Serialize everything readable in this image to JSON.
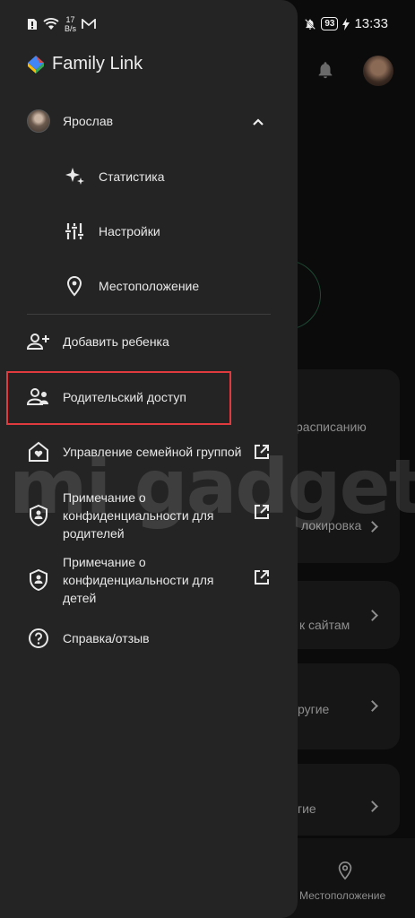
{
  "status_bar": {
    "net_speed_value": "17",
    "net_speed_unit": "B/s",
    "battery": "93",
    "time": "13:33"
  },
  "drawer": {
    "app_name": "Family Link",
    "account": {
      "name": "Ярослав"
    },
    "sub_items": [
      {
        "label": "Статистика",
        "icon": "sparkle-icon"
      },
      {
        "label": "Настройки",
        "icon": "tune-icon"
      },
      {
        "label": "Местоположение",
        "icon": "location-pin-icon"
      }
    ],
    "items": [
      {
        "label": "Добавить ребенка",
        "icon": "add-person-icon"
      },
      {
        "label": "Родительский доступ",
        "icon": "parent-access-icon"
      },
      {
        "label": "Управление семейной группой",
        "icon": "family-home-icon",
        "external": true
      },
      {
        "label": "Примечание о конфиденциальности для родителей",
        "icon": "shield-person-icon",
        "external": true
      },
      {
        "label": "Примечание о конфиденциальности для детей",
        "icon": "shield-person-icon",
        "external": true
      },
      {
        "label": "Справка/отзыв",
        "icon": "help-icon"
      }
    ]
  },
  "background": {
    "cards": [
      "расписанию",
      "локировка",
      "к сайтам",
      "ругие",
      "гие"
    ],
    "bottom_nav_label": "Местоположение"
  },
  "watermark": "mi gadget",
  "colors": {
    "drawer_bg": "#242424",
    "highlight": "#e0393e",
    "text": "#e8e8e8"
  }
}
